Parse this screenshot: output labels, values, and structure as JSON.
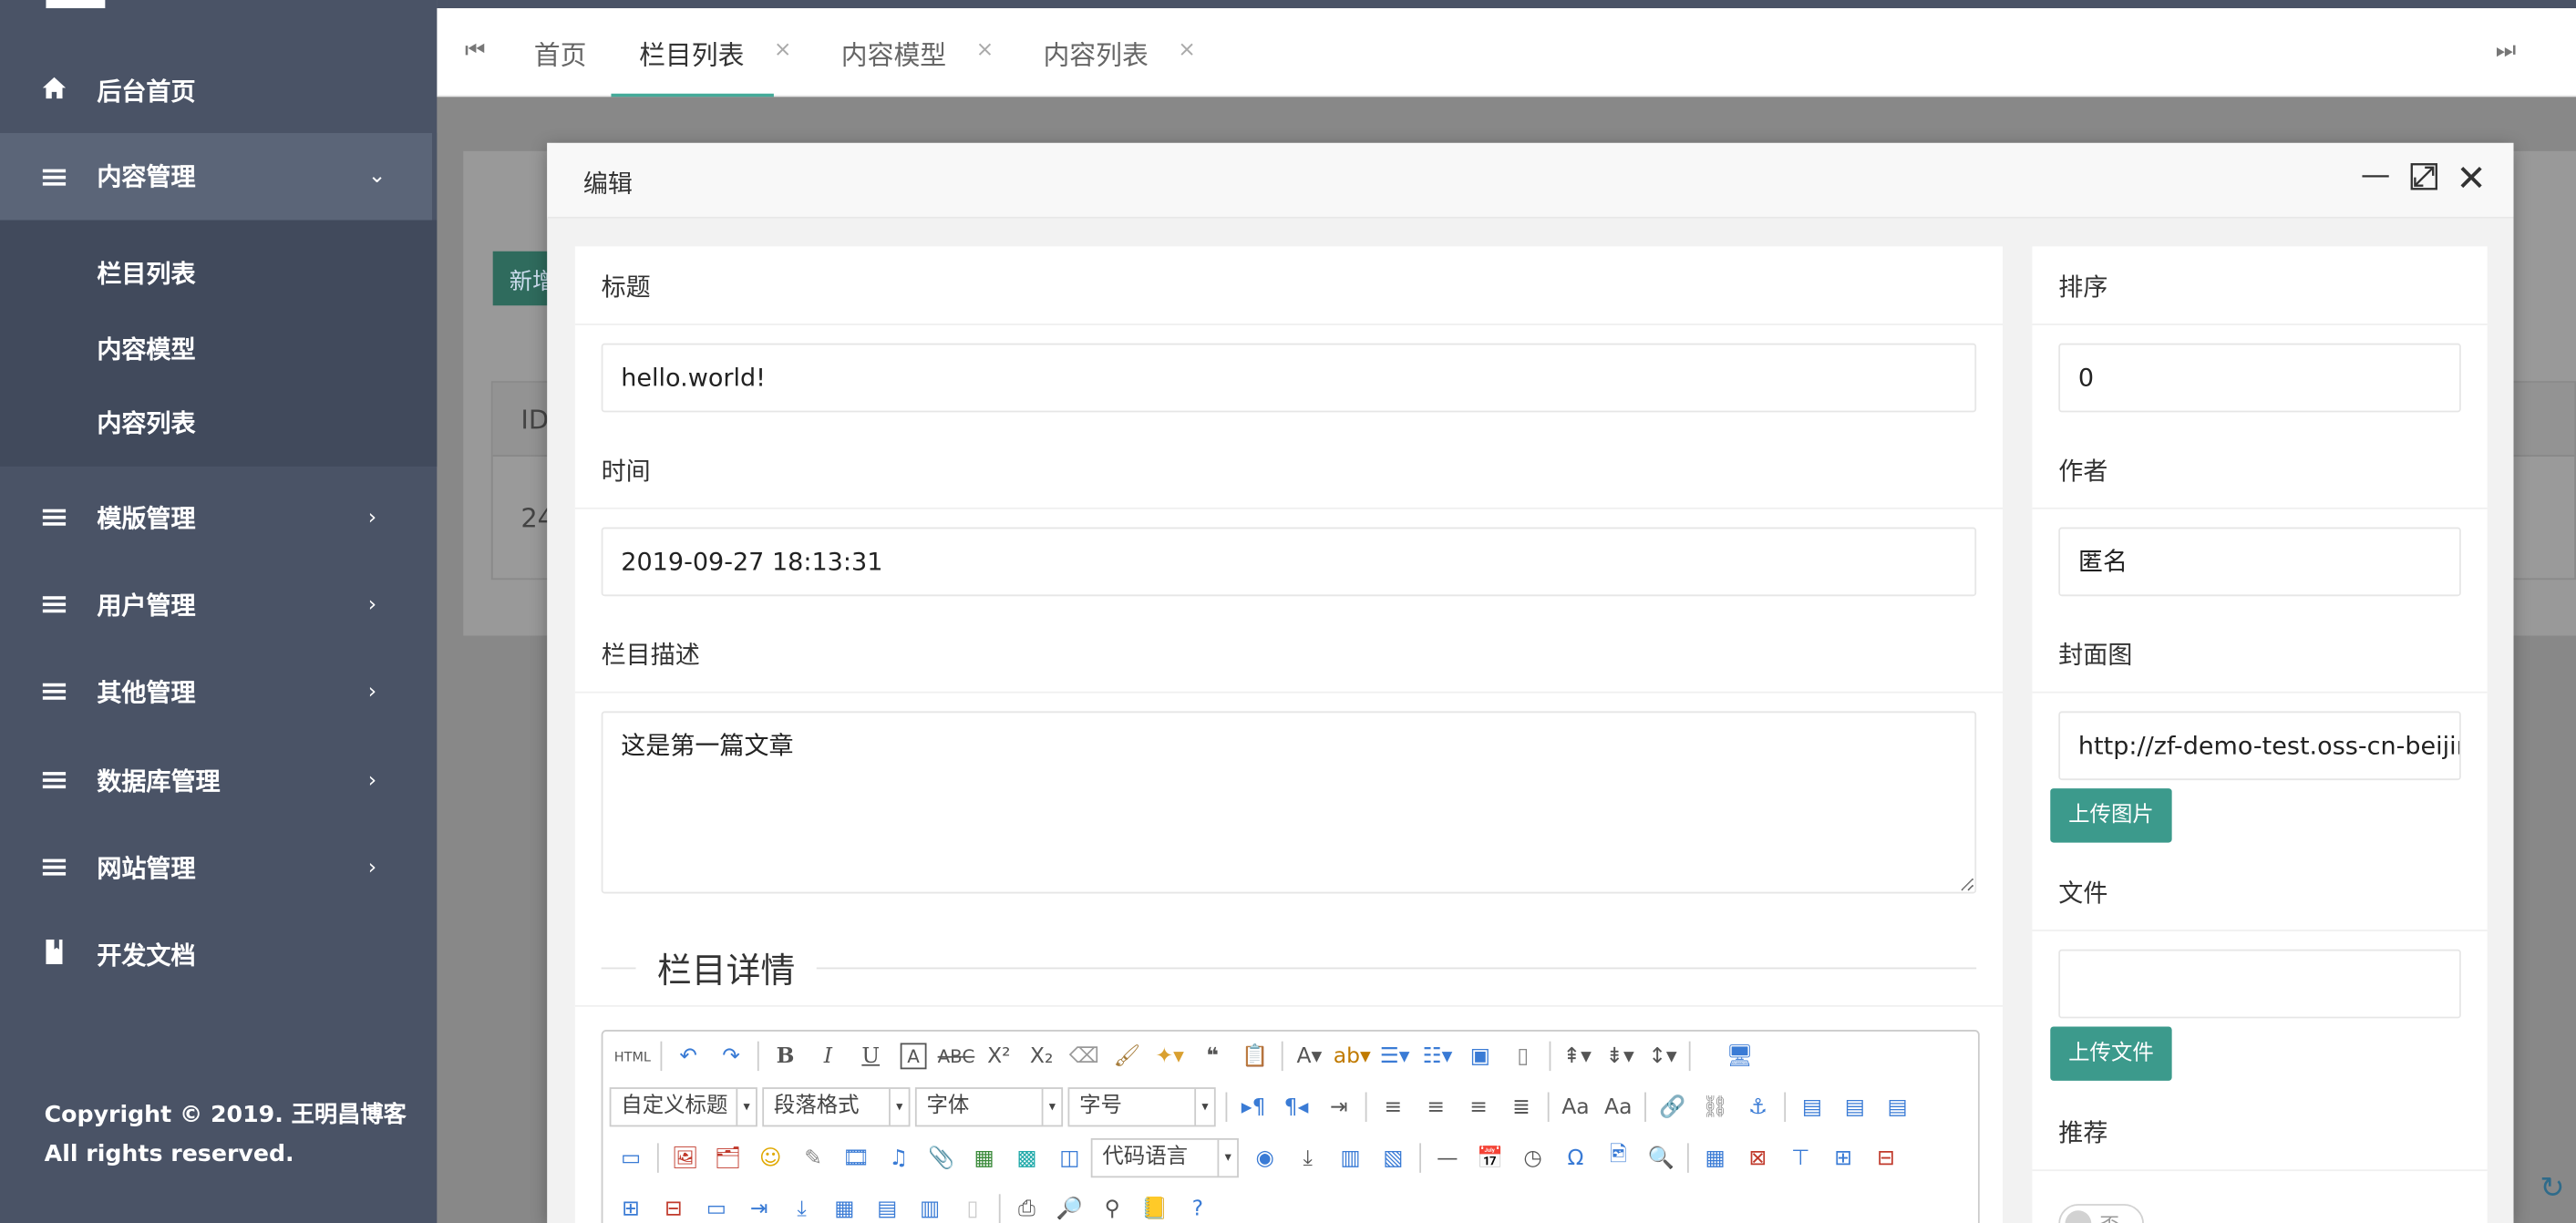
{
  "sidebar": {
    "items": [
      {
        "label": "后台首页",
        "icon": "home-icon"
      },
      {
        "label": "内容管理",
        "icon": "menu-icon",
        "expanded": true
      },
      {
        "label": "模版管理",
        "icon": "menu-icon"
      },
      {
        "label": "用户管理",
        "icon": "menu-icon"
      },
      {
        "label": "其他管理",
        "icon": "menu-icon"
      },
      {
        "label": "数据库管理",
        "icon": "menu-icon"
      },
      {
        "label": "网站管理",
        "icon": "menu-icon"
      },
      {
        "label": "开发文档",
        "icon": "document-icon"
      }
    ],
    "submenu": [
      "栏目列表",
      "内容模型",
      "内容列表"
    ],
    "copyright": [
      "Copyright © 2019. 王明昌博客",
      "All rights reserved."
    ]
  },
  "tabs": [
    {
      "label": "首页",
      "closable": false
    },
    {
      "label": "栏目列表",
      "closable": true,
      "active": true
    },
    {
      "label": "内容模型",
      "closable": true
    },
    {
      "label": "内容列表",
      "closable": true
    }
  ],
  "background": {
    "add_button": "新增",
    "table_header_first": "ID",
    "table_cell_first": "24"
  },
  "modal": {
    "title": "编辑",
    "left": {
      "title_label": "标题",
      "title_value": "hello.world!",
      "time_label": "时间",
      "time_value": "2019-09-27 18:13:31",
      "desc_label": "栏目描述",
      "desc_value": "这是第一篇文章",
      "detail_legend": "栏目详情"
    },
    "right": {
      "sort_label": "排序",
      "sort_value": "0",
      "author_label": "作者",
      "author_value": "匿名",
      "cover_label": "封面图",
      "cover_value": "http://zf-demo-test.oss-cn-beijing",
      "upload_image_button": "上传图片",
      "file_label": "文件",
      "file_value": "",
      "upload_file_button": "上传文件",
      "recommend_label": "推荐",
      "recommend_value": "否"
    }
  },
  "editor": {
    "custom_heading": "自定义标题",
    "paragraph_format": "段落格式",
    "font_family": "字体",
    "font_size": "字号",
    "code_language": "代码语言",
    "html_label": "HTML"
  },
  "colors": {
    "sidebar_bg": "#4a5366",
    "primary_button": "#3c9a8c",
    "tab_active_underline": "#44aa99"
  }
}
